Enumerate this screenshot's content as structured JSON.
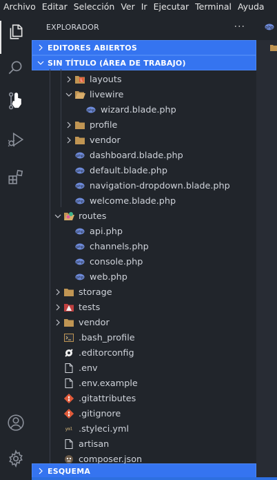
{
  "menu": [
    "Archivo",
    "Editar",
    "Selección",
    "Ver",
    "Ir",
    "Ejecutar",
    "Terminal",
    "Ayuda"
  ],
  "sidebar": {
    "title": "EXPLORADOR",
    "more": "···",
    "open_editors": "EDITORES ABIERTOS",
    "workspace": "SIN TÍTULO (ÁREA DE TRABAJO)",
    "outline": "ESQUEMA"
  },
  "tree": [
    {
      "label": "layouts",
      "type": "folder-layout",
      "depth": 2,
      "expanded": false
    },
    {
      "label": "livewire",
      "type": "folder-open",
      "depth": 2,
      "expanded": true
    },
    {
      "label": "wizard.blade.php",
      "type": "blade",
      "depth": 3
    },
    {
      "label": "profile",
      "type": "folder",
      "depth": 2,
      "expanded": false
    },
    {
      "label": "vendor",
      "type": "folder",
      "depth": 2,
      "expanded": false
    },
    {
      "label": "dashboard.blade.php",
      "type": "blade",
      "depth": 2
    },
    {
      "label": "default.blade.php",
      "type": "blade",
      "depth": 2
    },
    {
      "label": "navigation-dropdown.blade.php",
      "type": "blade",
      "depth": 2
    },
    {
      "label": "welcome.blade.php",
      "type": "blade",
      "depth": 2
    },
    {
      "label": "routes",
      "type": "folder-routes",
      "depth": 1,
      "expanded": true
    },
    {
      "label": "api.php",
      "type": "php",
      "depth": 2
    },
    {
      "label": "channels.php",
      "type": "php",
      "depth": 2
    },
    {
      "label": "console.php",
      "type": "php",
      "depth": 2
    },
    {
      "label": "web.php",
      "type": "php",
      "depth": 2
    },
    {
      "label": "storage",
      "type": "folder",
      "depth": 1,
      "expanded": false
    },
    {
      "label": "tests",
      "type": "folder-tests",
      "depth": 1,
      "expanded": false
    },
    {
      "label": "vendor",
      "type": "folder",
      "depth": 1,
      "expanded": false
    },
    {
      "label": ".bash_profile",
      "type": "terminal",
      "depth": 1
    },
    {
      "label": ".editorconfig",
      "type": "editorconfig",
      "depth": 1
    },
    {
      "label": ".env",
      "type": "file",
      "depth": 1
    },
    {
      "label": ".env.example",
      "type": "file",
      "depth": 1
    },
    {
      "label": ".gitattributes",
      "type": "git",
      "depth": 1
    },
    {
      "label": ".gitignore",
      "type": "git",
      "depth": 1
    },
    {
      "label": ".styleci.yml",
      "type": "yaml",
      "depth": 1
    },
    {
      "label": "artisan",
      "type": "file",
      "depth": 1
    },
    {
      "label": "composer.json",
      "type": "composer",
      "depth": 1
    }
  ],
  "colors": {
    "accent": "#3574f0",
    "folder": "#c09553",
    "blade": "#6d8ad9",
    "git": "#e05a3a"
  }
}
